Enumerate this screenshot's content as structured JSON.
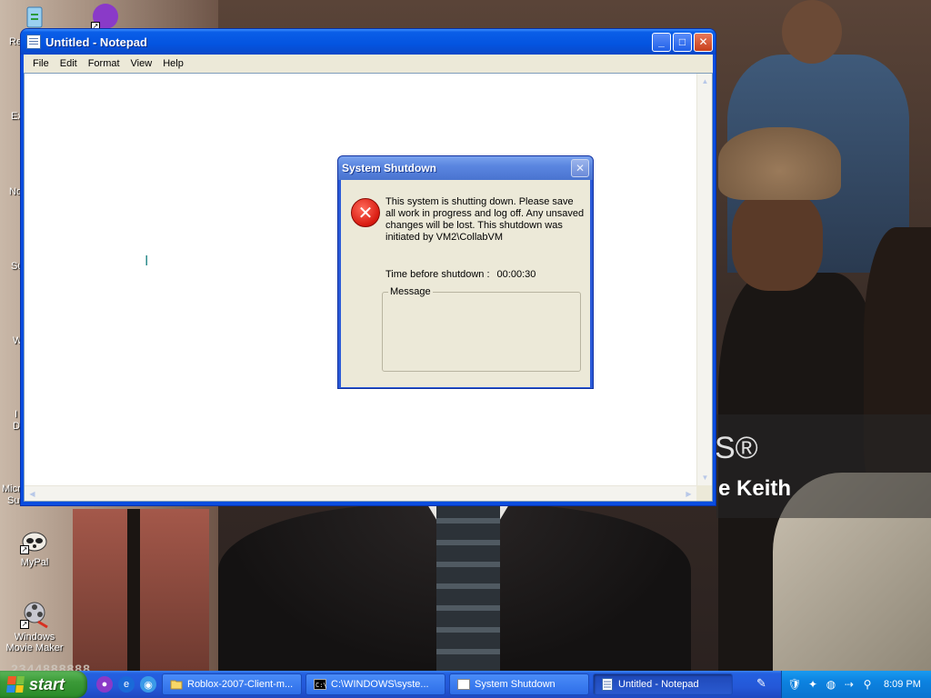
{
  "desktop": {
    "icons": [
      {
        "id": "mypal",
        "label": "MyPal"
      },
      {
        "id": "moviemaker",
        "label": "Windows Movie Maker"
      }
    ],
    "edge_labels": [
      "Re",
      "Ex",
      "No",
      "Su",
      "W",
      "I",
      "D",
      "Micr",
      "Su"
    ],
    "wallpaper_text": "e Keith",
    "wallpaper_symbol": "S®",
    "overlay_digits": "2344888888"
  },
  "notepad": {
    "title": "Untitled - Notepad",
    "menu": [
      "File",
      "Edit",
      "Format",
      "View",
      "Help"
    ],
    "controls": {
      "minimize": "_",
      "maximize": "□",
      "close": "✕"
    },
    "content": ""
  },
  "shutdown_dialog": {
    "title": "System Shutdown",
    "close_glyph": "✕",
    "icon_glyph": "✕",
    "message": "This system is shutting down. Please save all work in progress and log off. Any unsaved changes will be lost. This shutdown was initiated by VM2\\CollabVM",
    "timer_label": "Time before shutdown :",
    "timer_value": "00:00:30",
    "message_group_label": "Message"
  },
  "taskbar": {
    "start_label": "start",
    "tasks": [
      {
        "label": "Roblox-2007-Client-m...",
        "active": false
      },
      {
        "label": "C:\\WINDOWS\\syste...",
        "active": false
      },
      {
        "label": "System Shutdown",
        "active": false
      },
      {
        "label": "Untitled - Notepad",
        "active": true
      }
    ],
    "clock": "8:09 PM"
  },
  "colors": {
    "xp_blue": "#0a4de0",
    "start_green": "#3c9a38",
    "tray_blue": "#0c82e0",
    "error_red": "#d81a10"
  }
}
